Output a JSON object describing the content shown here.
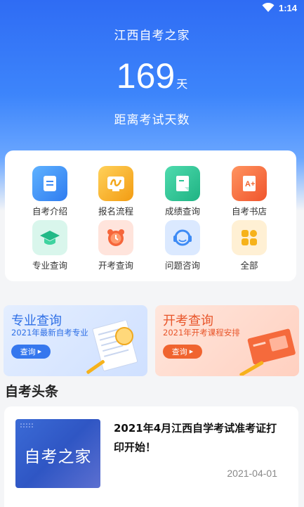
{
  "status": {
    "time": "1:14"
  },
  "header": {
    "title": "江西自考之家",
    "days": "169",
    "days_unit": "天",
    "caption": "距离考试天数"
  },
  "menu": {
    "items": [
      {
        "label": "自考介绍",
        "icon": "document-icon",
        "color": "#3e8bf5"
      },
      {
        "label": "报名流程",
        "icon": "process-icon",
        "color": "#f6b21b"
      },
      {
        "label": "成绩查询",
        "icon": "score-icon",
        "color": "#2fc597"
      },
      {
        "label": "自考书店",
        "icon": "book-icon",
        "color": "#f6663b"
      },
      {
        "label": "专业查询",
        "icon": "graduation-cap-icon",
        "color": "#25c28f"
      },
      {
        "label": "开考查询",
        "icon": "alarm-clock-icon",
        "color": "#f6663b"
      },
      {
        "label": "问题咨询",
        "icon": "headset-icon",
        "color": "#3e8bf5"
      },
      {
        "label": "全部",
        "icon": "grid-icon",
        "color": "#f6b21b"
      }
    ]
  },
  "promos": [
    {
      "title": "专业查询",
      "subtitle": "2021年最新自考专业",
      "button": "查询",
      "accent": "#3577ee"
    },
    {
      "title": "开考查询",
      "subtitle": "2021年开考课程安排",
      "button": "查询",
      "accent": "#f0642f"
    }
  ],
  "news": {
    "section_title": "自考头条",
    "items": [
      {
        "thumb_text": "自考之家",
        "title": "2021年4月江西自学考试准考证打印开始！",
        "date": "2021-04-01"
      }
    ]
  }
}
